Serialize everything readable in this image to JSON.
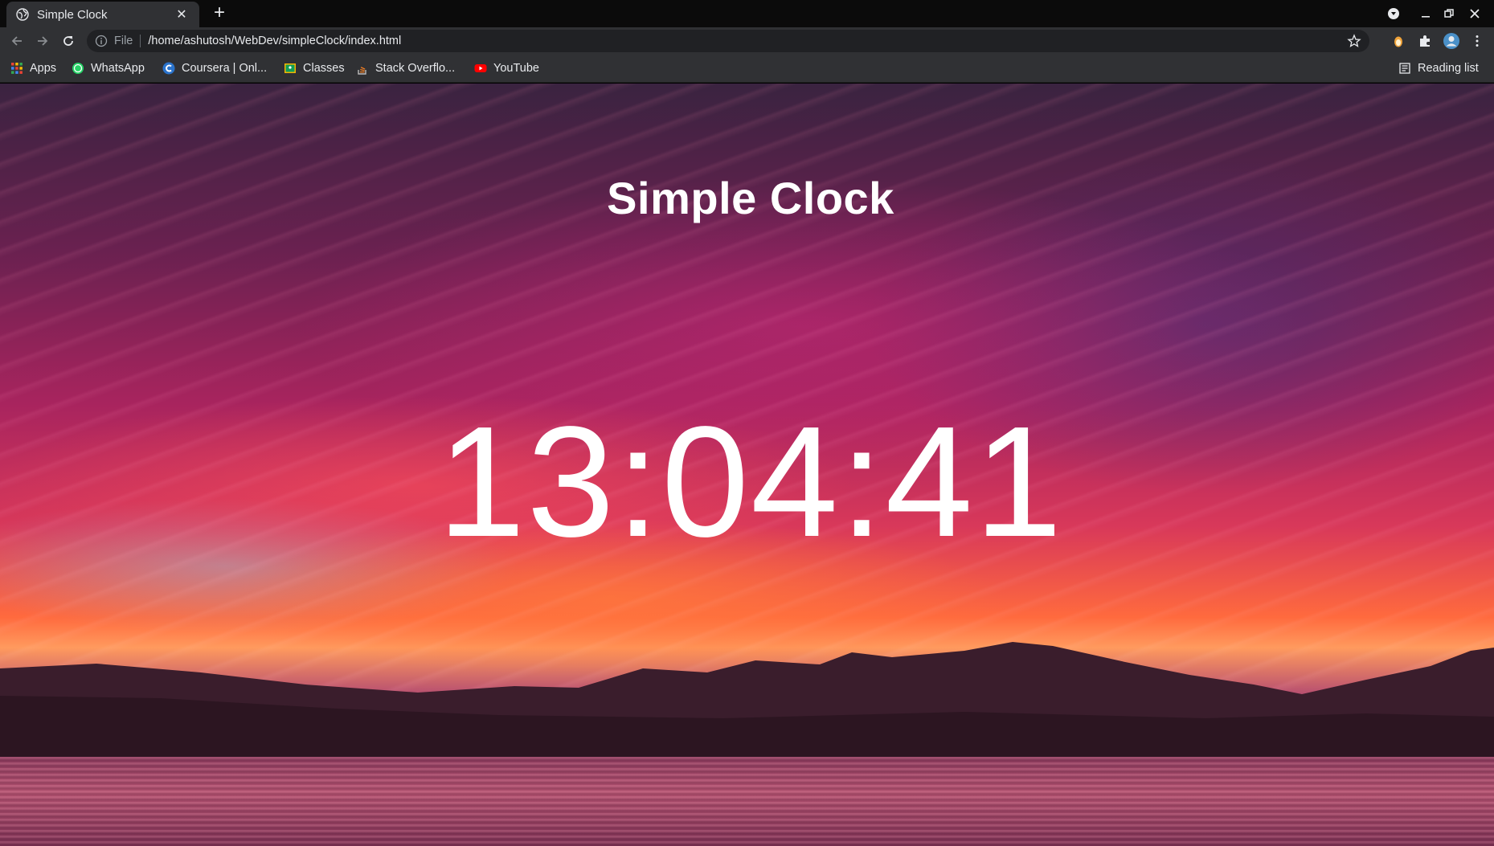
{
  "tab": {
    "title": "Simple Clock"
  },
  "omnibox": {
    "scheme": "File",
    "url": "/home/ashutosh/WebDev/simpleClock/index.html"
  },
  "bookmarks": [
    {
      "label": "Apps",
      "icon": "apps-grid-icon"
    },
    {
      "label": "WhatsApp",
      "icon": "whatsapp-icon"
    },
    {
      "label": "Coursera | Onl...",
      "icon": "coursera-icon"
    },
    {
      "label": "Classes",
      "icon": "google-classroom-icon"
    },
    {
      "label": "Stack Overflo...",
      "icon": "stack-overflow-icon"
    },
    {
      "label": "YouTube",
      "icon": "youtube-icon"
    }
  ],
  "reading_list": {
    "label": "Reading list"
  },
  "page": {
    "title": "Simple Clock",
    "time": "13:04:41"
  },
  "colors": {
    "text": "#ffffff",
    "chrome_dark": "#303134",
    "tabstrip": "#0b0b0b"
  }
}
